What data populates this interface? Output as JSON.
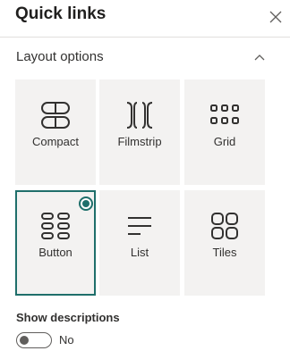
{
  "panel": {
    "title": "Quick links"
  },
  "section": {
    "title": "Layout options"
  },
  "layouts": [
    {
      "label": "Compact",
      "icon": "compact-layout-icon",
      "selected": false
    },
    {
      "label": "Filmstrip",
      "icon": "filmstrip-layout-icon",
      "selected": false
    },
    {
      "label": "Grid",
      "icon": "grid-layout-icon",
      "selected": false
    },
    {
      "label": "Button",
      "icon": "button-layout-icon",
      "selected": true
    },
    {
      "label": "List",
      "icon": "list-layout-icon",
      "selected": false
    },
    {
      "label": "Tiles",
      "icon": "tiles-layout-icon",
      "selected": false
    }
  ],
  "descriptions": {
    "label": "Show descriptions",
    "state_text": "No",
    "on": false
  },
  "colors": {
    "accent": "#1f6f6b",
    "tile_bg": "#f3f2f1",
    "icon": "#323130"
  }
}
